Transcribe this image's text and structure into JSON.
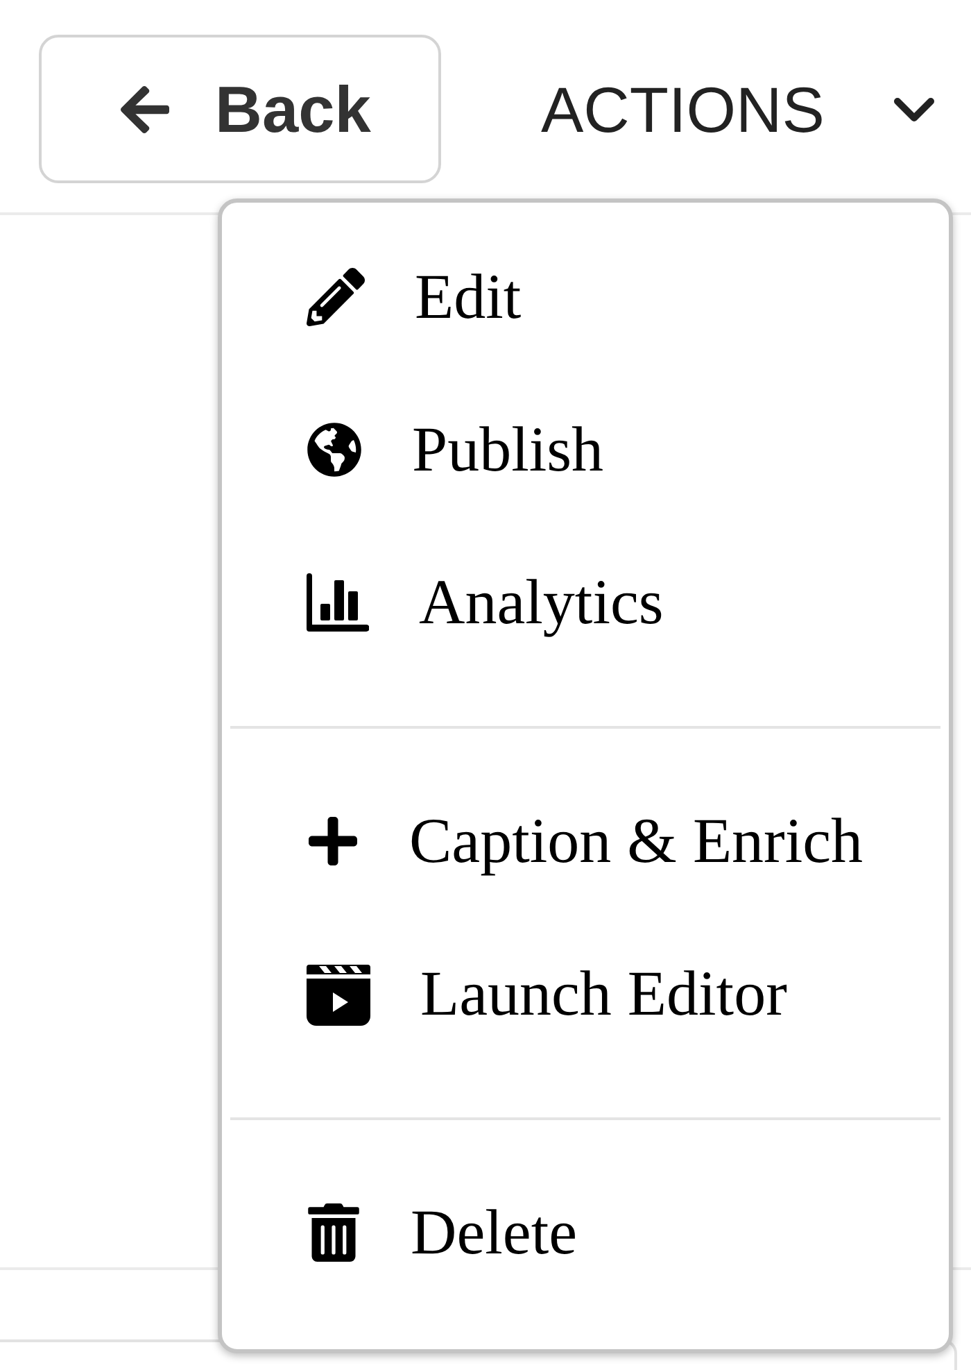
{
  "back_button": {
    "label": "Back"
  },
  "actions_menu": {
    "label": "ACTIONS",
    "expanded": true,
    "groups": [
      {
        "items": [
          {
            "label": "Edit"
          },
          {
            "label": "Publish"
          },
          {
            "label": "Analytics"
          }
        ]
      },
      {
        "items": [
          {
            "label": "Caption & Enrich"
          },
          {
            "label": "Launch Editor"
          }
        ]
      },
      {
        "items": [
          {
            "label": "Delete"
          }
        ]
      }
    ]
  }
}
